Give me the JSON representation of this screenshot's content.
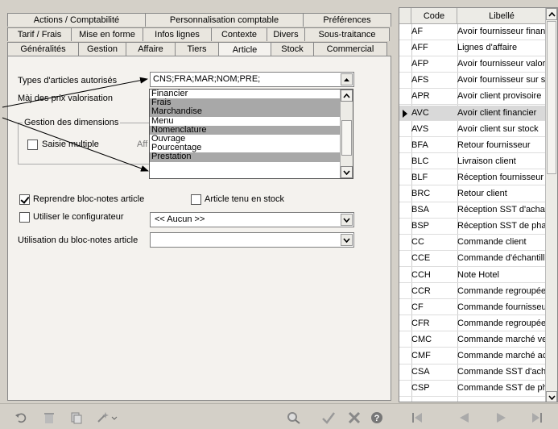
{
  "tabs": {
    "row1": [
      "Actions / Comptabilité",
      "Personnalisation comptable",
      "Préférences"
    ],
    "row2": [
      "Tarif / Frais",
      "Mise en forme",
      "Infos lignes",
      "Contexte",
      "Divers",
      "Sous-traitance"
    ],
    "row3": [
      "Généralités",
      "Gestion",
      "Affaire",
      "Tiers",
      "Article",
      "Stock",
      "Commercial"
    ],
    "active": "Article"
  },
  "form": {
    "types_label": "Types d'articles autorisés",
    "types_value": "CNS;FRA;MAR;NOM;PRE;",
    "maj_label": "Màj des prix valorisation",
    "dimensions_group": "Gestion des dimensions",
    "saisie_multiple": "Saisie multiple",
    "aff_label": "Aff",
    "reprendre_label": "Reprendre bloc-notes article",
    "reprendre_checked": true,
    "tenu_stock_label": "Article tenu en stock",
    "tenu_stock_checked": false,
    "configurateur_label": "Utiliser le configurateur",
    "configurateur_checked": false,
    "configurateur_value": "<< Aucun >>",
    "utilisation_label": "Utilisation du bloc-notes article",
    "utilisation_value": ""
  },
  "dropdown": {
    "items": [
      {
        "label": "Financier",
        "selected": false
      },
      {
        "label": "Frais",
        "selected": true
      },
      {
        "label": "Marchandise",
        "selected": true
      },
      {
        "label": "Menu",
        "selected": false
      },
      {
        "label": "Nomenclature",
        "selected": true
      },
      {
        "label": "Ouvrage",
        "selected": false
      },
      {
        "label": "Pourcentage",
        "selected": false
      },
      {
        "label": "Prestation",
        "selected": true
      }
    ]
  },
  "list": {
    "header_code": "Code",
    "header_libelle": "Libellé",
    "rows": [
      {
        "code": "AF",
        "libelle": "Avoir fournisseur financ"
      },
      {
        "code": "AFF",
        "libelle": "Lignes d'affaire"
      },
      {
        "code": "AFP",
        "libelle": "Avoir fournisseur valori:"
      },
      {
        "code": "AFS",
        "libelle": "Avoir fournisseur sur st"
      },
      {
        "code": "APR",
        "libelle": "Avoir client provisoire"
      },
      {
        "code": "AVC",
        "libelle": "Avoir client financier",
        "selected": true
      },
      {
        "code": "AVS",
        "libelle": "Avoir client sur stock"
      },
      {
        "code": "BFA",
        "libelle": "Retour fournisseur"
      },
      {
        "code": "BLC",
        "libelle": "Livraison client"
      },
      {
        "code": "BLF",
        "libelle": "Réception fournisseur"
      },
      {
        "code": "BRC",
        "libelle": "Retour client"
      },
      {
        "code": "BSA",
        "libelle": "Réception SST d'acha"
      },
      {
        "code": "BSP",
        "libelle": "Réception SST de pha"
      },
      {
        "code": "CC",
        "libelle": "Commande client"
      },
      {
        "code": "CCE",
        "libelle": "Commande d'échantillc"
      },
      {
        "code": "CCH",
        "libelle": "Note Hotel"
      },
      {
        "code": "CCR",
        "libelle": "Commande regroupée"
      },
      {
        "code": "CF",
        "libelle": "Commande fournisseur"
      },
      {
        "code": "CFR",
        "libelle": "Commande regroupée"
      },
      {
        "code": "CMC",
        "libelle": "Commande marché ver"
      },
      {
        "code": "CMF",
        "libelle": "Commande marché acl"
      },
      {
        "code": "CSA",
        "libelle": "Commande SST d'ach."
      },
      {
        "code": "CSP",
        "libelle": "Commande SST de ph"
      }
    ]
  },
  "toolbar": {
    "icons": [
      "undo-icon",
      "delete-icon",
      "copy-icon",
      "wizard-icon",
      "search-icon",
      "validate-icon",
      "cancel-icon",
      "help-icon",
      "first-icon",
      "previous-icon",
      "next-icon",
      "last-icon"
    ]
  }
}
